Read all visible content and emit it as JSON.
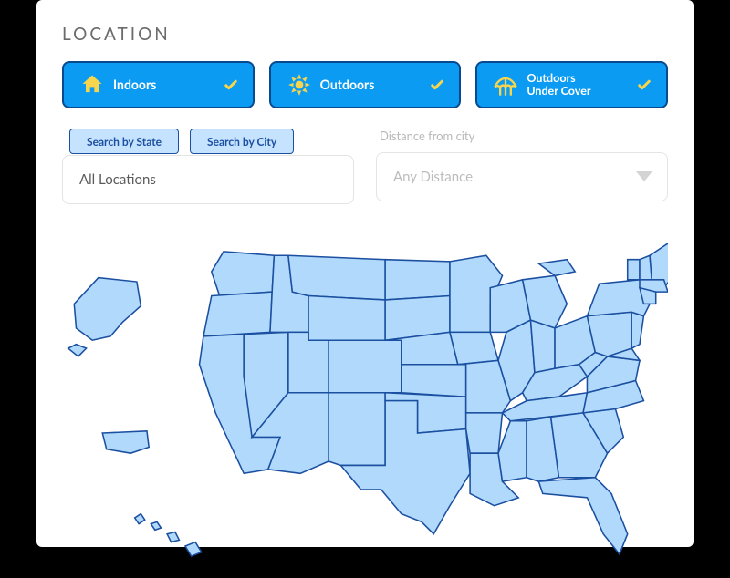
{
  "section": {
    "title": "LOCATION"
  },
  "toggles": {
    "indoors": {
      "label": "Indoors"
    },
    "outdoors": {
      "label": "Outdoors"
    },
    "under_cover": {
      "label": "Outdoors\nUnder Cover"
    }
  },
  "search": {
    "state_tab": "Search by State",
    "city_tab": "Search by City",
    "locations_value": "All Locations",
    "distance_label": "Distance from city",
    "distance_placeholder": "Any Distance"
  }
}
